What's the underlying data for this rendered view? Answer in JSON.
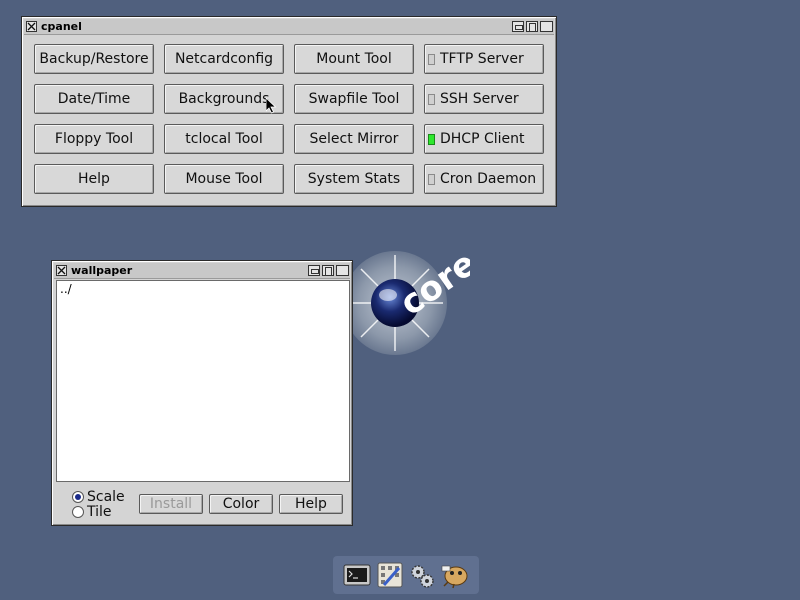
{
  "cpanel": {
    "title": "cpanel",
    "buttons": [
      {
        "label": "Backup/Restore"
      },
      {
        "label": "Netcardconfig"
      },
      {
        "label": "Mount Tool"
      },
      {
        "label": "TFTP Server",
        "led": "off"
      },
      {
        "label": "Date/Time"
      },
      {
        "label": "Backgrounds"
      },
      {
        "label": "Swapfile Tool"
      },
      {
        "label": "SSH Server",
        "led": "off"
      },
      {
        "label": "Floppy Tool"
      },
      {
        "label": "tclocal Tool"
      },
      {
        "label": "Select Mirror"
      },
      {
        "label": "DHCP Client",
        "led": "on"
      },
      {
        "label": "Help"
      },
      {
        "label": "Mouse Tool"
      },
      {
        "label": "System Stats"
      },
      {
        "label": "Cron Daemon",
        "led": "off"
      }
    ]
  },
  "wallpaper": {
    "title": "wallpaper",
    "list_items": [
      "../"
    ],
    "radio_scale": "Scale",
    "radio_tile": "Tile",
    "selected_mode": "Scale",
    "install_label": "Install",
    "color_label": "Color",
    "help_label": "Help"
  },
  "desktop": {
    "logo_text": "core",
    "background_color": "#50607e",
    "led_on_color": "#2ee82e"
  },
  "taskbar": {
    "icons": [
      "terminal-icon",
      "control-panel-icon",
      "settings-gears-icon",
      "app-launcher-icon"
    ]
  }
}
